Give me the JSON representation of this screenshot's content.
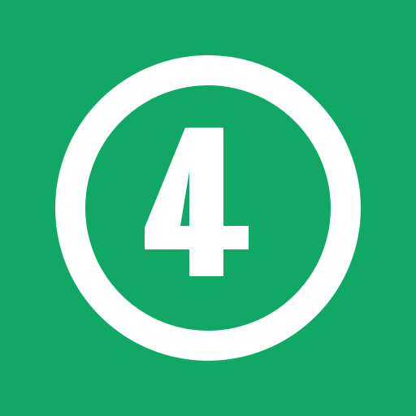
{
  "badge": {
    "number": "4",
    "background_color": "#10a864",
    "foreground_color": "#ffffff",
    "icon": "number-4-in-circle-icon"
  }
}
